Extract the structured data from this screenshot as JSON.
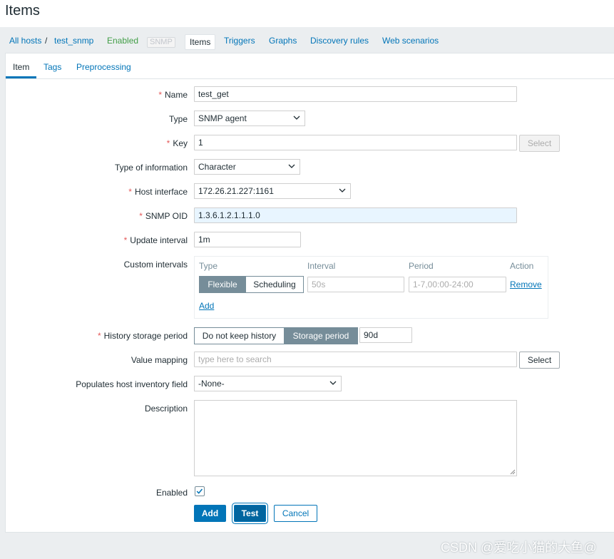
{
  "page": {
    "title": "Items"
  },
  "nav": {
    "all_hosts": "All hosts",
    "separator": "/",
    "host": "test_snmp",
    "status": "Enabled",
    "snmp": "SNMP",
    "items": "Items",
    "triggers": "Triggers",
    "graphs": "Graphs",
    "discovery_rules": "Discovery rules",
    "web_scenarios": "Web scenarios"
  },
  "tabs": {
    "item": "Item",
    "tags": "Tags",
    "preprocessing": "Preprocessing"
  },
  "form": {
    "required_mark": "*",
    "name": {
      "label": "Name",
      "value": "test_get"
    },
    "type": {
      "label": "Type",
      "value": "SNMP agent"
    },
    "key": {
      "label": "Key",
      "value": "1",
      "select": "Select"
    },
    "type_of_information": {
      "label": "Type of information",
      "value": "Character"
    },
    "host_interface": {
      "label": "Host interface",
      "value": "172.26.21.227:1161"
    },
    "snmp_oid": {
      "label": "SNMP OID",
      "value": "1.3.6.1.2.1.1.1.0"
    },
    "update_interval": {
      "label": "Update interval",
      "value": "1m"
    },
    "custom_intervals": {
      "label": "Custom intervals",
      "col_type": "Type",
      "col_interval": "Interval",
      "col_period": "Period",
      "col_action": "Action",
      "flexible": "Flexible",
      "scheduling": "Scheduling",
      "interval_placeholder": "50s",
      "period_placeholder": "1-7,00:00-24:00",
      "remove": "Remove",
      "add": "Add"
    },
    "history": {
      "label": "History storage period",
      "do_not_keep": "Do not keep history",
      "storage_period": "Storage period",
      "value": "90d"
    },
    "value_mapping": {
      "label": "Value mapping",
      "placeholder": "type here to search",
      "select": "Select"
    },
    "inventory": {
      "label": "Populates host inventory field",
      "value": "-None-"
    },
    "description": {
      "label": "Description"
    },
    "enabled": {
      "label": "Enabled",
      "checked": true
    },
    "buttons": {
      "add": "Add",
      "test": "Test",
      "cancel": "Cancel"
    }
  },
  "watermark": "CSDN @爱吃小猫的大鱼@",
  "colors": {
    "link": "#0275b8",
    "enabled": "#429e47",
    "required": "#e45959",
    "segment": "#768d99"
  }
}
